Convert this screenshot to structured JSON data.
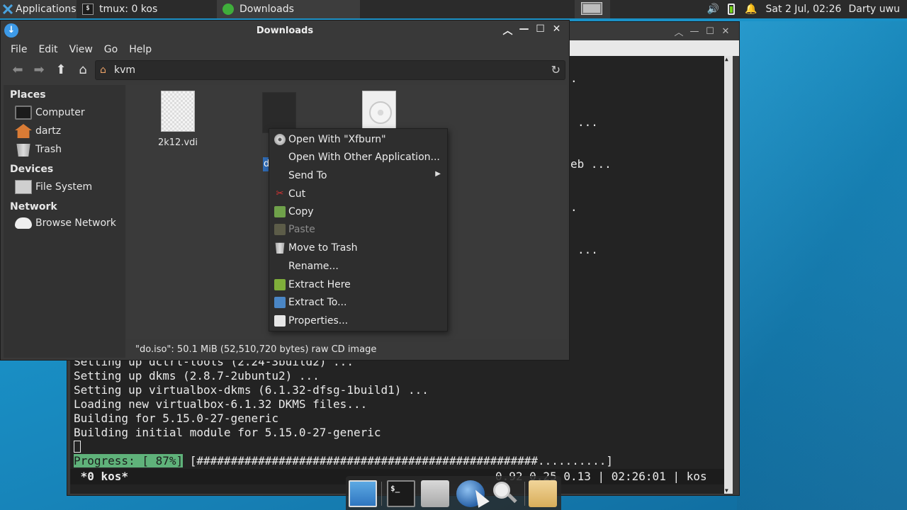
{
  "top_panel": {
    "applications_label": "Applications",
    "tasks": [
      {
        "label": "tmux: 0 kos",
        "icon": "terminal-icon"
      },
      {
        "label": "Downloads",
        "icon": "download-icon"
      }
    ],
    "clock": "Sat  2 Jul, 02:26",
    "user": "Darty uwu"
  },
  "terminal": {
    "fragments": [
      ".",
      "...",
      "eb ...",
      ".",
      "..."
    ],
    "lines": [
      "Setting up dctrl-tools (2.24-3build2) ...",
      "Setting up dkms (2.8.7-2ubuntu2) ...",
      "Setting up virtualbox-dkms (6.1.32-dfsg-1build1) ...",
      "Loading new virtualbox-6.1.32 DKMS files...",
      "Building for 5.15.0-27-generic",
      "Building initial module for 5.15.0-27-generic"
    ],
    "progress_label": "Progress: [ 87%]",
    "progress_value": 87,
    "progress_bar": "[##################################################..........]",
    "status_left": " *0 kos*",
    "status_right": "0.92 0.25 0.13 | 02:26:01 | kos"
  },
  "file_manager": {
    "title": "Downloads",
    "menu": [
      "File",
      "Edit",
      "View",
      "Go",
      "Help"
    ],
    "location": "kvm",
    "sidebar": {
      "places_header": "Places",
      "places": [
        "Computer",
        "dartz",
        "Trash"
      ],
      "devices_header": "Devices",
      "devices": [
        "File System"
      ],
      "network_header": "Network",
      "network": [
        "Browse Network"
      ]
    },
    "files": [
      {
        "name": "2k12.vdi"
      },
      {
        "name": "d"
      },
      {
        "name": ""
      }
    ],
    "status": "\"do.iso\": 50.1 MiB (52,510,720 bytes) raw CD image"
  },
  "context_menu": {
    "items": [
      {
        "label": "Open With \"Xfburn\"",
        "icon": "disc-icon"
      },
      {
        "label": "Open With Other Application...",
        "icon": ""
      },
      {
        "label": "Send To",
        "icon": "",
        "submenu": true
      },
      {
        "label": "Cut",
        "icon": "scissors-icon"
      },
      {
        "label": "Copy",
        "icon": "copy-icon"
      },
      {
        "label": "Paste",
        "icon": "paste-icon",
        "disabled": true
      },
      {
        "label": "Move to Trash",
        "icon": "trash-icon"
      },
      {
        "label": "Rename...",
        "icon": ""
      },
      {
        "label": "Extract Here",
        "icon": "extract-icon"
      },
      {
        "label": "Extract To...",
        "icon": "extract-to-icon"
      },
      {
        "label": "Properties...",
        "icon": "properties-icon"
      }
    ]
  },
  "dock": [
    "desktop-icon",
    "terminal-icon",
    "file-manager-icon",
    "web-browser-icon",
    "search-icon",
    "folder-icon"
  ],
  "colors": {
    "accent": "#2f6bb5",
    "progress": "#5fb27a",
    "panel": "#2b2b2b"
  }
}
